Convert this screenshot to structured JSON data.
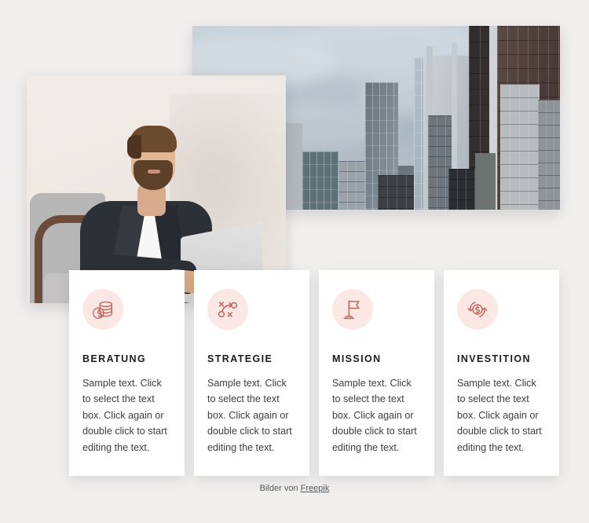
{
  "page": {
    "background_color": "#f0efee",
    "accent_color": "#c4685f",
    "icon_circle_color": "#fbe8e4"
  },
  "media": {
    "city_photo": {
      "name": "city-skyscrapers-photo",
      "alt": "Glass and concrete skyscrapers photographed from street level against an overcast grey sky"
    },
    "person_photo": {
      "name": "businessman-laptop-photo",
      "alt": "Bearded businessman in a dark blazer and white t-shirt typing on a laptop while seated in a grey armchair"
    }
  },
  "cards": [
    {
      "icon": "coins-stack-dollar-icon",
      "title": "BERATUNG",
      "text": "Sample text. Click to select the text box. Click again or double click to start editing the text."
    },
    {
      "icon": "strategy-tactics-board-icon",
      "title": "STRATEGIE",
      "text": "Sample text. Click to select the text box. Click again or double click to start editing the text."
    },
    {
      "icon": "flag-on-stand-icon",
      "title": "MISSION",
      "text": "Sample text. Click to select the text box. Click again or double click to start editing the text."
    },
    {
      "icon": "dollar-exchange-arrows-icon",
      "title": "INVESTITION",
      "text": "Sample text. Click to select the text box. Click again or double click to start editing the text."
    }
  ],
  "footer": {
    "prefix": "Bilder von ",
    "link_label": "Freepik"
  }
}
